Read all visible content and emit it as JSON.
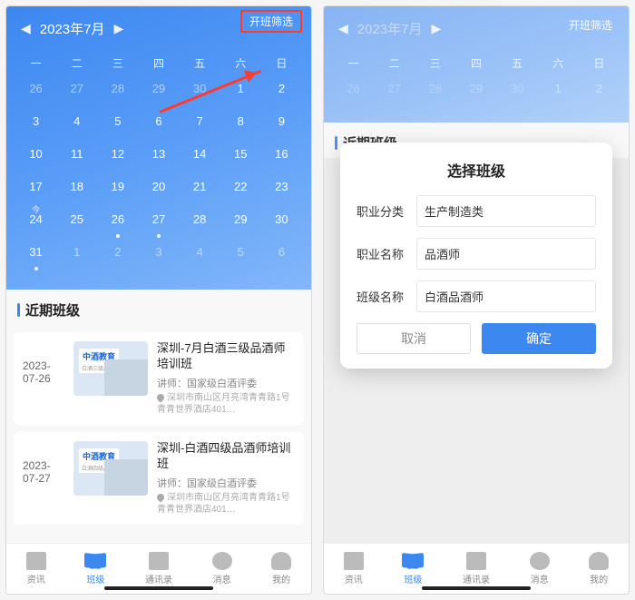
{
  "calendar": {
    "title": "2023年7月",
    "filter_label": "开班筛选",
    "dow": [
      "一",
      "二",
      "三",
      "四",
      "五",
      "六",
      "日"
    ],
    "days": [
      {
        "n": "26",
        "dim": true
      },
      {
        "n": "27",
        "dim": true
      },
      {
        "n": "28",
        "dim": true
      },
      {
        "n": "29",
        "dim": true
      },
      {
        "n": "30",
        "dim": true
      },
      {
        "n": "1"
      },
      {
        "n": "2"
      },
      {
        "n": "3"
      },
      {
        "n": "4"
      },
      {
        "n": "5"
      },
      {
        "n": "6"
      },
      {
        "n": "7"
      },
      {
        "n": "8"
      },
      {
        "n": "9"
      },
      {
        "n": "10"
      },
      {
        "n": "11"
      },
      {
        "n": "12"
      },
      {
        "n": "13"
      },
      {
        "n": "14"
      },
      {
        "n": "15"
      },
      {
        "n": "16"
      },
      {
        "n": "17"
      },
      {
        "n": "18"
      },
      {
        "n": "19"
      },
      {
        "n": "20"
      },
      {
        "n": "21"
      },
      {
        "n": "22"
      },
      {
        "n": "23"
      },
      {
        "n": "24",
        "tag": "今"
      },
      {
        "n": "25"
      },
      {
        "n": "26",
        "dot": true
      },
      {
        "n": "27",
        "dot": true
      },
      {
        "n": "28"
      },
      {
        "n": "29"
      },
      {
        "n": "30"
      },
      {
        "n": "31",
        "dot": true
      },
      {
        "n": "1",
        "dim": true
      },
      {
        "n": "2",
        "dim": true
      },
      {
        "n": "3",
        "dim": true
      },
      {
        "n": "4",
        "dim": true
      },
      {
        "n": "5",
        "dim": true
      },
      {
        "n": "6",
        "dim": true
      }
    ]
  },
  "section_title": "近期班级",
  "courses": [
    {
      "date": "2023-07-26",
      "brand": "中酒教育",
      "brand_sub": "白酒三级品酒师",
      "title": "深圳-7月白酒三级品酒师培训班",
      "lecturer": "讲师：国家级白酒评委",
      "address": "深圳市南山区月亮湾青青路1号青青世界酒店401…"
    },
    {
      "date": "2023-07-27",
      "brand": "中酒教育",
      "brand_sub": "白酒四级品酒师",
      "title": "深圳-白酒四级品酒师培训班",
      "lecturer": "讲师：国家级白酒评委",
      "address": "深圳市南山区月亮湾青青路1号青青世界酒店401…"
    }
  ],
  "tabs": [
    {
      "label": "资讯"
    },
    {
      "label": "班级"
    },
    {
      "label": "通讯录"
    },
    {
      "label": "消息"
    },
    {
      "label": "我的"
    }
  ],
  "modal": {
    "title": "选择班级",
    "rows": [
      {
        "label": "职业分类",
        "value": "生产制造类"
      },
      {
        "label": "职业名称",
        "value": "品酒师"
      },
      {
        "label": "班级名称",
        "value": "白酒品酒师"
      }
    ],
    "cancel": "取消",
    "confirm": "确定"
  }
}
